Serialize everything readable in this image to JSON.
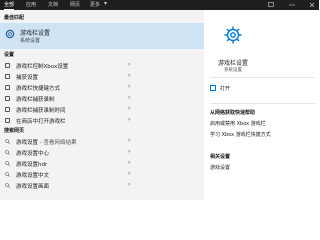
{
  "topbar": {
    "tabs": [
      {
        "label": "全部"
      },
      {
        "label": "应用"
      },
      {
        "label": "文档"
      },
      {
        "label": "网页"
      },
      {
        "label": "更多"
      }
    ],
    "more_icon": "ellipsis-icon",
    "feedback_icon": "feedback-icon",
    "close_icon": "close-icon"
  },
  "left": {
    "best_match": {
      "section_label": "最佳匹配",
      "title": "游戏栏设置",
      "subtitle": "系统设置",
      "icon": "gear-icon"
    },
    "settings_section": {
      "label": "设置"
    },
    "settings_rows": [
      {
        "label": "游戏栏控制Xbox设置"
      },
      {
        "label": "捕获设置"
      },
      {
        "label": "游戏栏快捷键方式"
      },
      {
        "label": "游戏栏捕获录制"
      },
      {
        "label": "游戏栏捕获录制时间"
      },
      {
        "label": "在商店中打开游戏栏"
      }
    ],
    "web_section": {
      "label": "搜索网页"
    },
    "web_rows": [
      {
        "label": "游戏设置",
        "suffix": "- 查看网络结果"
      },
      {
        "label": "游戏设置中心"
      },
      {
        "label": "游戏设置hdr"
      },
      {
        "label": "游戏设置中文"
      },
      {
        "label": "游戏设置画面"
      }
    ]
  },
  "right": {
    "app_title": "游戏栏设置",
    "app_subtitle": "系统设置",
    "open_label": "打开",
    "help_title": "从网络获取快速帮助",
    "help_items": [
      {
        "label": "启用或禁用 Xbox 游戏栏"
      },
      {
        "label": "学习 Xbox 游戏栏快捷方式"
      }
    ],
    "related_title": "相关设置",
    "related_items": [
      {
        "label": "游戏设置"
      }
    ]
  },
  "colors": {
    "accent": "#0078d4",
    "highlight": "#cfe3f5"
  }
}
